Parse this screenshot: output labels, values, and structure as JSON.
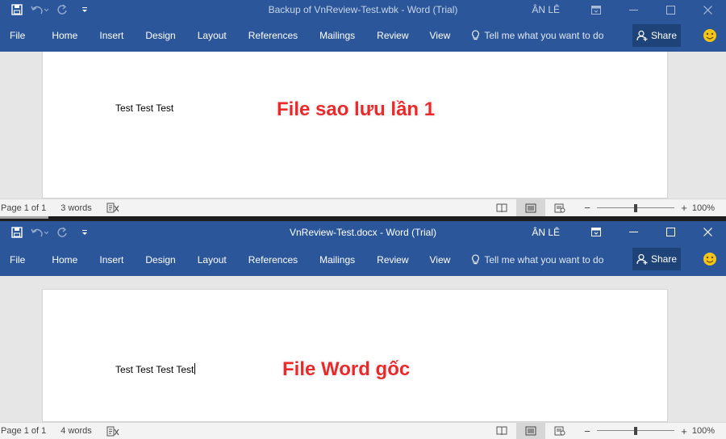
{
  "windows": [
    {
      "id": "backup",
      "title": "Backup of VnReview-Test.wbk  -  Word (Trial)",
      "user": "ÂN LÊ",
      "ribbon_tabs": [
        "File",
        "Home",
        "Insert",
        "Design",
        "Layout",
        "References",
        "Mailings",
        "Review",
        "View"
      ],
      "tell_me": "Tell me what you want to do",
      "share": "Share",
      "doc_text": "Test Test Test",
      "annotation": "File sao lưu lần 1",
      "status": {
        "page": "Page 1 of 1",
        "words": "3 words",
        "zoom": "100%",
        "zoom_percent": 100
      }
    },
    {
      "id": "original",
      "title": "VnReview-Test.docx  -  Word (Trial)",
      "user": "ÂN LÊ",
      "ribbon_tabs": [
        "File",
        "Home",
        "Insert",
        "Design",
        "Layout",
        "References",
        "Mailings",
        "Review",
        "View"
      ],
      "tell_me": "Tell me what you want to do",
      "share": "Share",
      "doc_text": "Test Test Test Test",
      "annotation": "File Word gốc",
      "status": {
        "page": "Page 1 of 1",
        "words": "4 words",
        "zoom": "100%",
        "zoom_percent": 100
      }
    }
  ],
  "colors": {
    "ribbon": "#2b579a",
    "share_button": "#1e4378",
    "annotation": "#ea2a2a",
    "statusbar": "#f3f3f3"
  },
  "icons": [
    "save-icon",
    "undo-icon",
    "redo-icon",
    "customize-qat-icon",
    "ribbon-display-icon",
    "minimize-icon",
    "maximize-icon",
    "close-icon",
    "lightbulb-icon",
    "person-icon",
    "smiley-icon",
    "proofing-icon",
    "read-mode-icon",
    "print-layout-icon",
    "web-layout-icon"
  ]
}
